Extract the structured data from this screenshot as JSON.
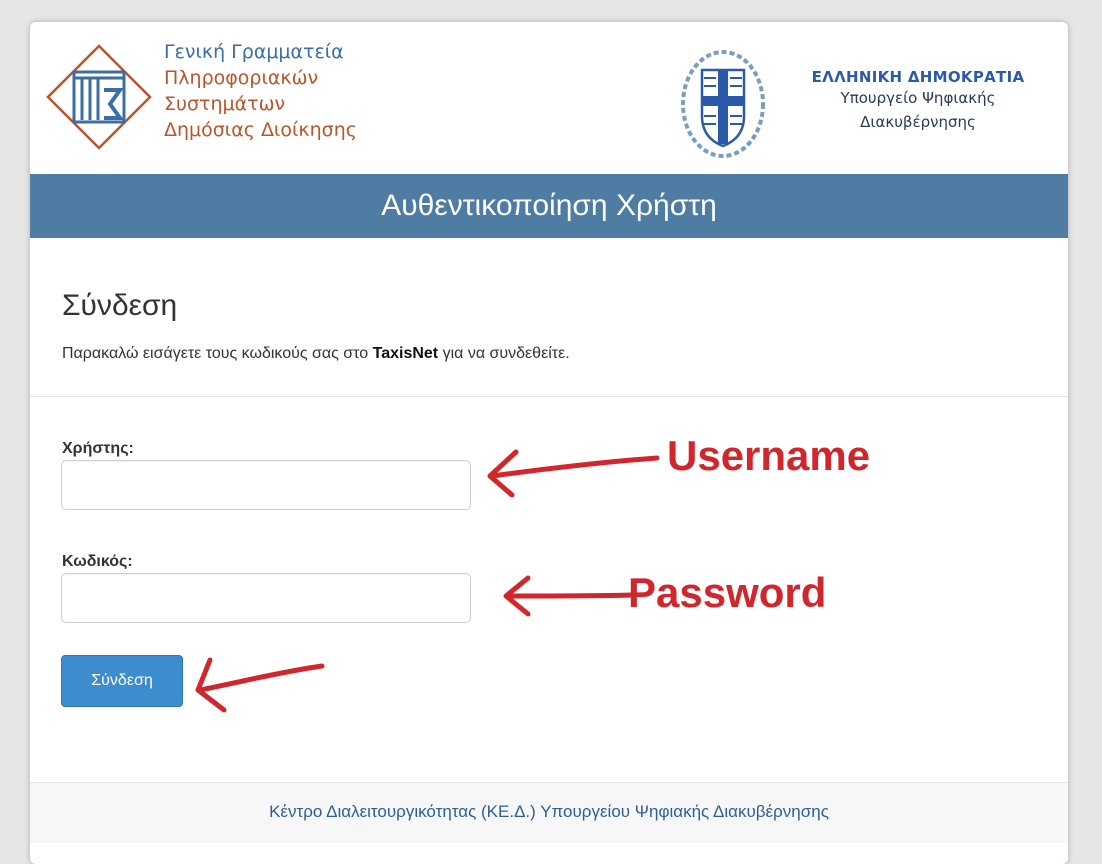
{
  "header": {
    "gsis_lines": [
      "Γενική Γραμματεία",
      "Πληροφοριακών",
      "Συστημάτων",
      "Δημόσιας Διοίκησης"
    ],
    "gov_title": "ΕΛΛΗΝΙΚΗ ΔΗΜΟΚΡΑΤΙΑ",
    "gov_sub_1": "Υπουργείο Ψηφιακής",
    "gov_sub_2": "Διακυβέρνησης"
  },
  "banner": {
    "title": "Αυθεντικοποίηση Χρήστη"
  },
  "login": {
    "heading": "Σύνδεση",
    "desc_before": "Παρακαλώ εισάγετε τους κωδικούς σας στο ",
    "desc_bold": "TaxisNet",
    "desc_after": " για να συνδεθείτε.",
    "username_label": "Χρήστης:",
    "username_value": "",
    "password_label": "Κωδικός:",
    "password_value": "",
    "submit_label": "Σύνδεση"
  },
  "annotations": {
    "username": "Username",
    "password": "Password"
  },
  "footer": {
    "text": "Κέντρο Διαλειτουργικότητας (ΚΕ.Δ.) Υπουργείου Ψηφιακής Διακυβέρνησης"
  },
  "colors": {
    "banner": "#4e7ca3",
    "button": "#3d8dce",
    "annotation": "#d0262c",
    "gsis_blue": "#3a6ea5",
    "gsis_orange": "#b8552a"
  }
}
